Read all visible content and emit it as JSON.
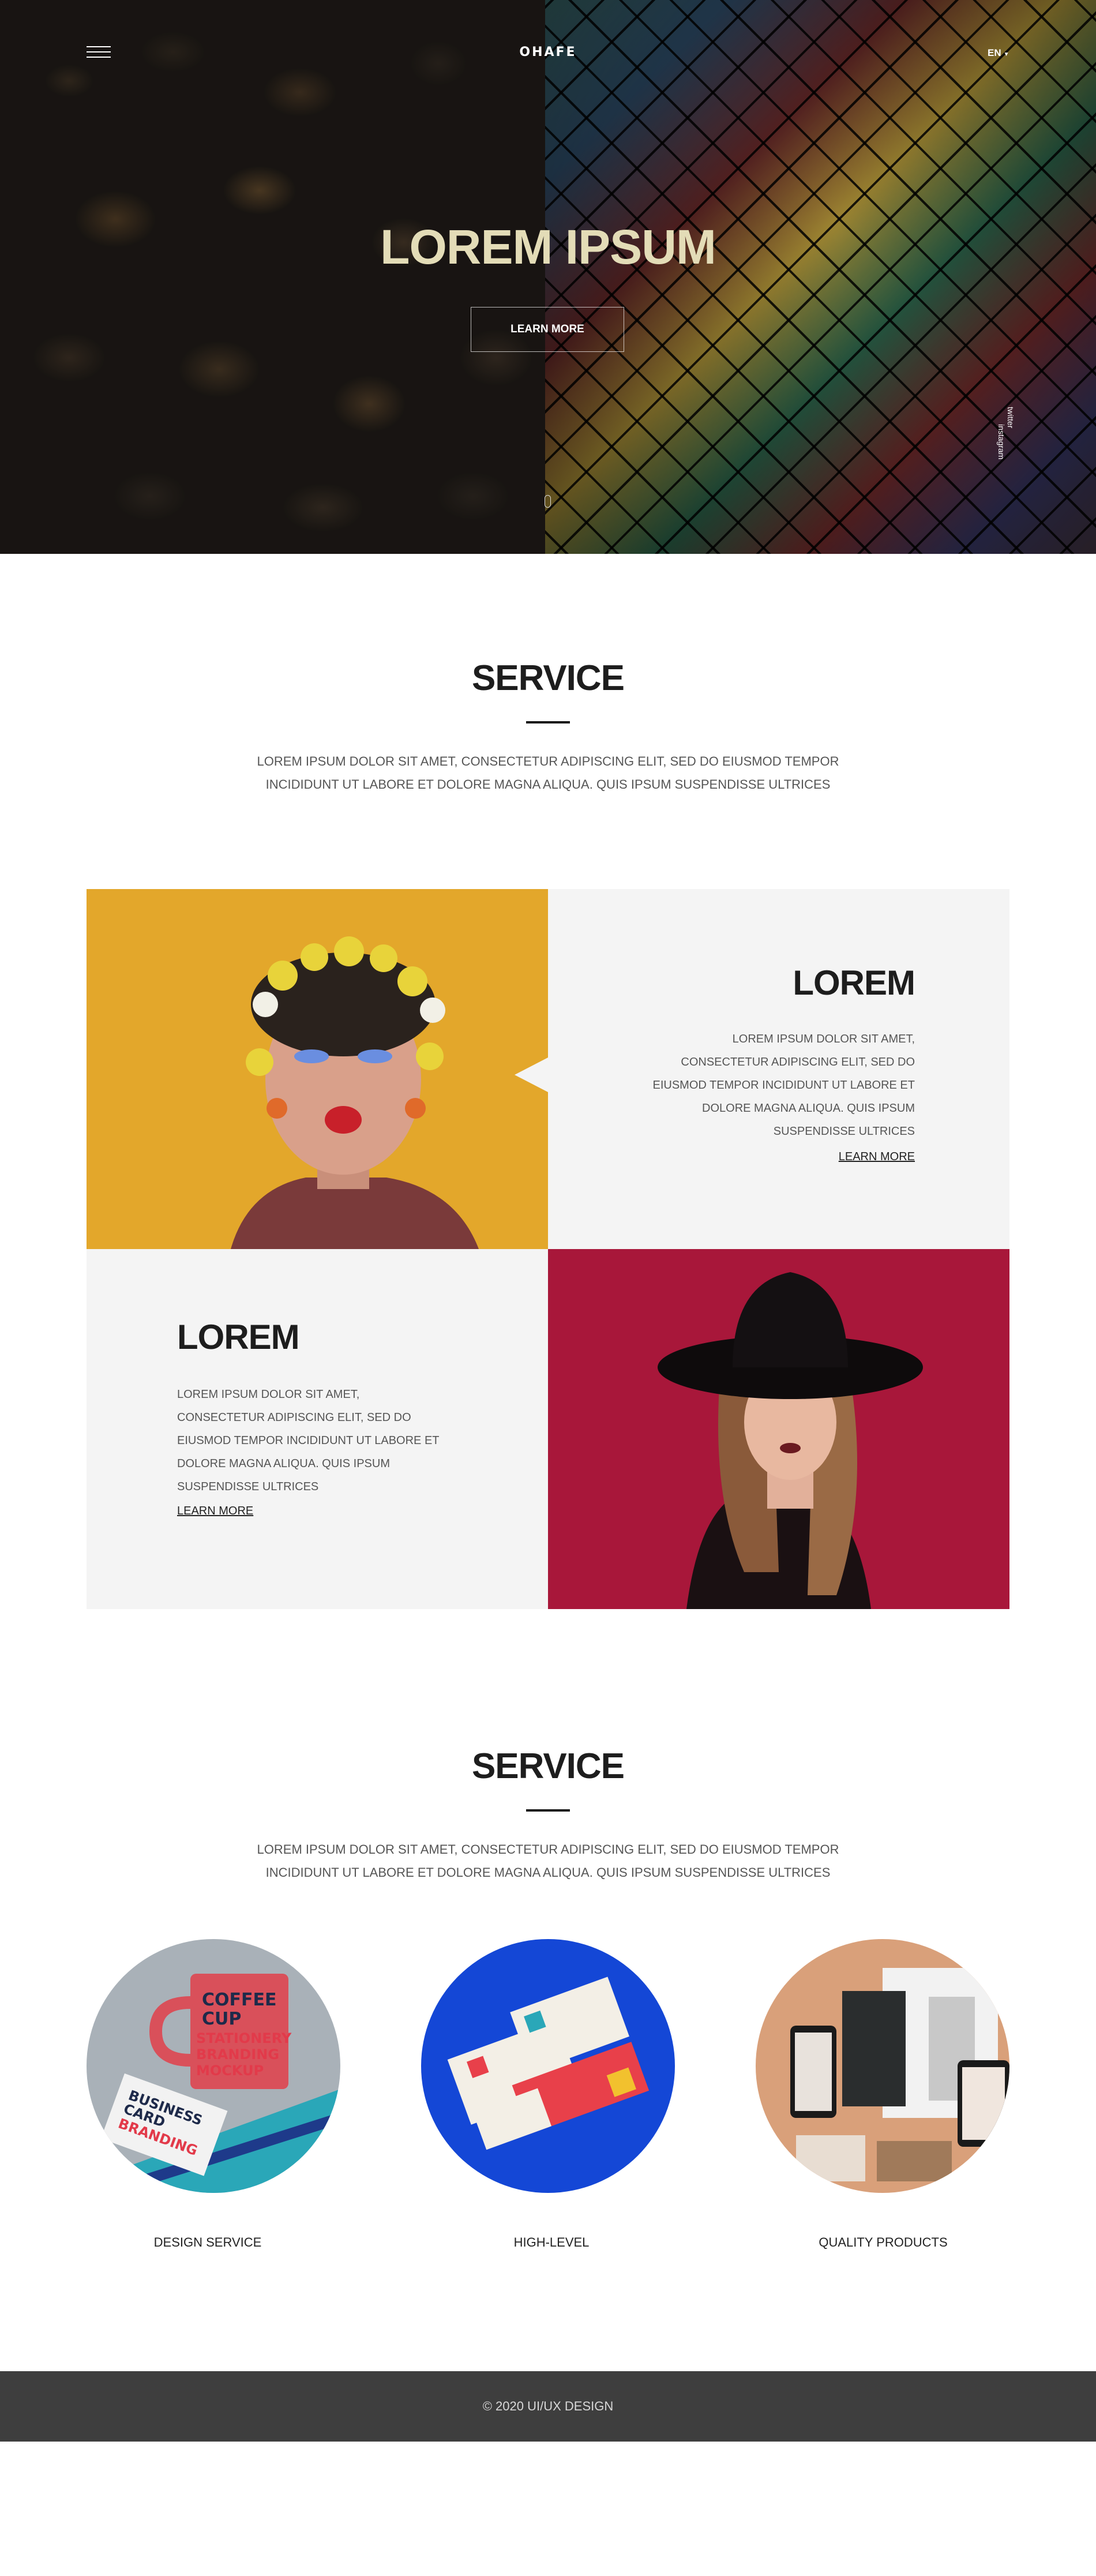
{
  "header": {
    "logo": "OHAFE",
    "language": "EN",
    "menu_icon": "hamburger-icon",
    "lang_caret_icon": "caret-down-icon"
  },
  "hero": {
    "title": "LOREM IPSUM",
    "button_label": "LEARN MORE",
    "social": [
      "twitter",
      "instagram"
    ],
    "scroll_icon": "mouse-scroll-icon",
    "title_color": "#e3dcb7"
  },
  "service1": {
    "title": "SERVICE",
    "description": "LOREM IPSUM DOLOR SIT AMET, CONSECTETUR ADIPISCING ELIT, SED DO EIUSMOD TEMPOR INCIDIDUNT UT LABORE ET DOLORE MAGNA ALIQUA. QUIS IPSUM SUSPENDISSE ULTRICES"
  },
  "features": [
    {
      "title": "LOREM",
      "text": "LOREM IPSUM DOLOR SIT AMET, CONSECTETUR ADIPISCING ELIT, SED DO EIUSMOD TEMPOR INCIDIDUNT UT LABORE ET DOLORE MAGNA ALIQUA. QUIS IPSUM SUSPENDISSE ULTRICES",
      "link": "LEARN MORE"
    },
    {
      "title": "LOREM",
      "text": "LOREM IPSUM DOLOR SIT AMET, CONSECTETUR ADIPISCING ELIT, SED DO EIUSMOD TEMPOR INCIDIDUNT UT LABORE ET DOLORE MAGNA ALIQUA. QUIS IPSUM SUSPENDISSE ULTRICES",
      "link": "LEARN MORE"
    }
  ],
  "service2": {
    "title": "SERVICE",
    "description": "LOREM IPSUM DOLOR SIT AMET, CONSECTETUR ADIPISCING ELIT, SED DO EIUSMOD TEMPOR INCIDIDUNT UT LABORE ET DOLORE MAGNA ALIQUA. QUIS IPSUM SUSPENDISSE ULTRICES",
    "items": [
      {
        "label": "DESIGN SERVICE",
        "image_text": [
          "COFFEE",
          "CUP",
          "STATIONERY",
          "BRANDING",
          "MOCKUP",
          "BUSINESS",
          "CARD",
          "BRANDING"
        ]
      },
      {
        "label": "HIGH-LEVEL"
      },
      {
        "label": "QUALITY PRODUCTS"
      }
    ]
  },
  "footer": {
    "copyright": "© 2020 UI/UX DESIGN"
  },
  "colors": {
    "footer_bg": "#3e3e3e",
    "card_bg": "#f4f4f4",
    "accent_yellow": "#e3a72b",
    "accent_crimson": "#a8173a",
    "accent_blue": "#1447d6",
    "accent_peach": "#d9a07a"
  }
}
